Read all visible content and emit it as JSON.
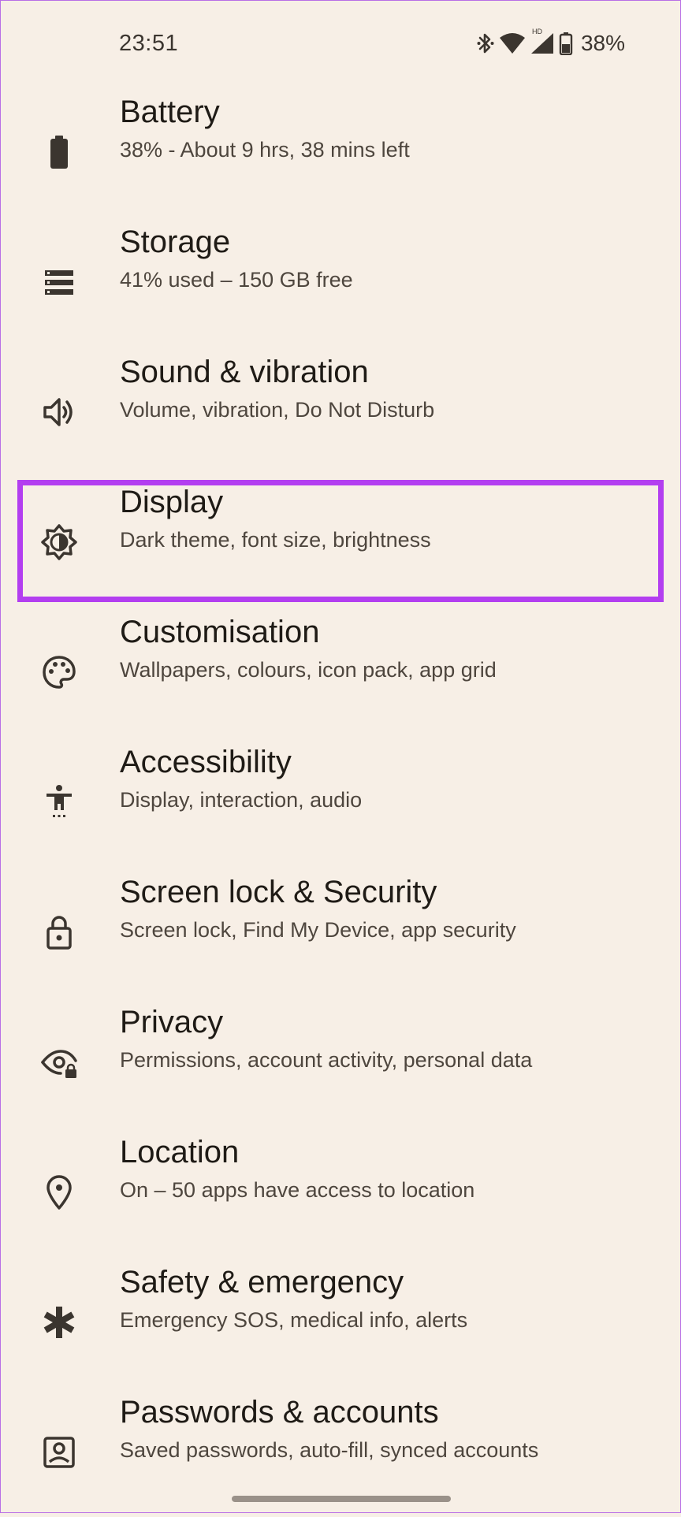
{
  "status_bar": {
    "time": "23:51",
    "network_badge": "HD",
    "battery_percent": "38%",
    "icons": [
      "bluetooth-icon",
      "wifi-icon",
      "cellular-signal-icon",
      "battery-icon"
    ]
  },
  "settings": {
    "items": [
      {
        "icon": "battery-icon",
        "title": "Battery",
        "subtitle": "38% - About 9 hrs, 38 mins left"
      },
      {
        "icon": "storage-icon",
        "title": "Storage",
        "subtitle": "41% used – 150 GB free"
      },
      {
        "icon": "volume-icon",
        "title": "Sound & vibration",
        "subtitle": "Volume, vibration, Do Not Disturb"
      },
      {
        "icon": "brightness-icon",
        "title": "Display",
        "subtitle": "Dark theme, font size, brightness",
        "highlighted": true
      },
      {
        "icon": "palette-icon",
        "title": "Customisation",
        "subtitle": "Wallpapers, colours, icon pack, app grid"
      },
      {
        "icon": "accessibility-icon",
        "title": "Accessibility",
        "subtitle": "Display, interaction, audio"
      },
      {
        "icon": "lock-icon",
        "title": "Screen lock & Security",
        "subtitle": "Screen lock, Find My Device, app security"
      },
      {
        "icon": "privacy-eye-icon",
        "title": "Privacy",
        "subtitle": "Permissions, account activity, personal data"
      },
      {
        "icon": "location-pin-icon",
        "title": "Location",
        "subtitle": "On – 50 apps have access to location"
      },
      {
        "icon": "emergency-asterisk-icon",
        "title": "Safety & emergency",
        "subtitle": "Emergency SOS, medical info, alerts"
      },
      {
        "icon": "account-box-icon",
        "title": "Passwords & accounts",
        "subtitle": "Saved passwords, auto-fill, synced accounts"
      }
    ]
  },
  "colors": {
    "background": "#f7efe6",
    "text_primary": "#1f1b16",
    "text_secondary": "#4e463e",
    "icon": "#3b352f",
    "highlight": "#b33ef0"
  }
}
